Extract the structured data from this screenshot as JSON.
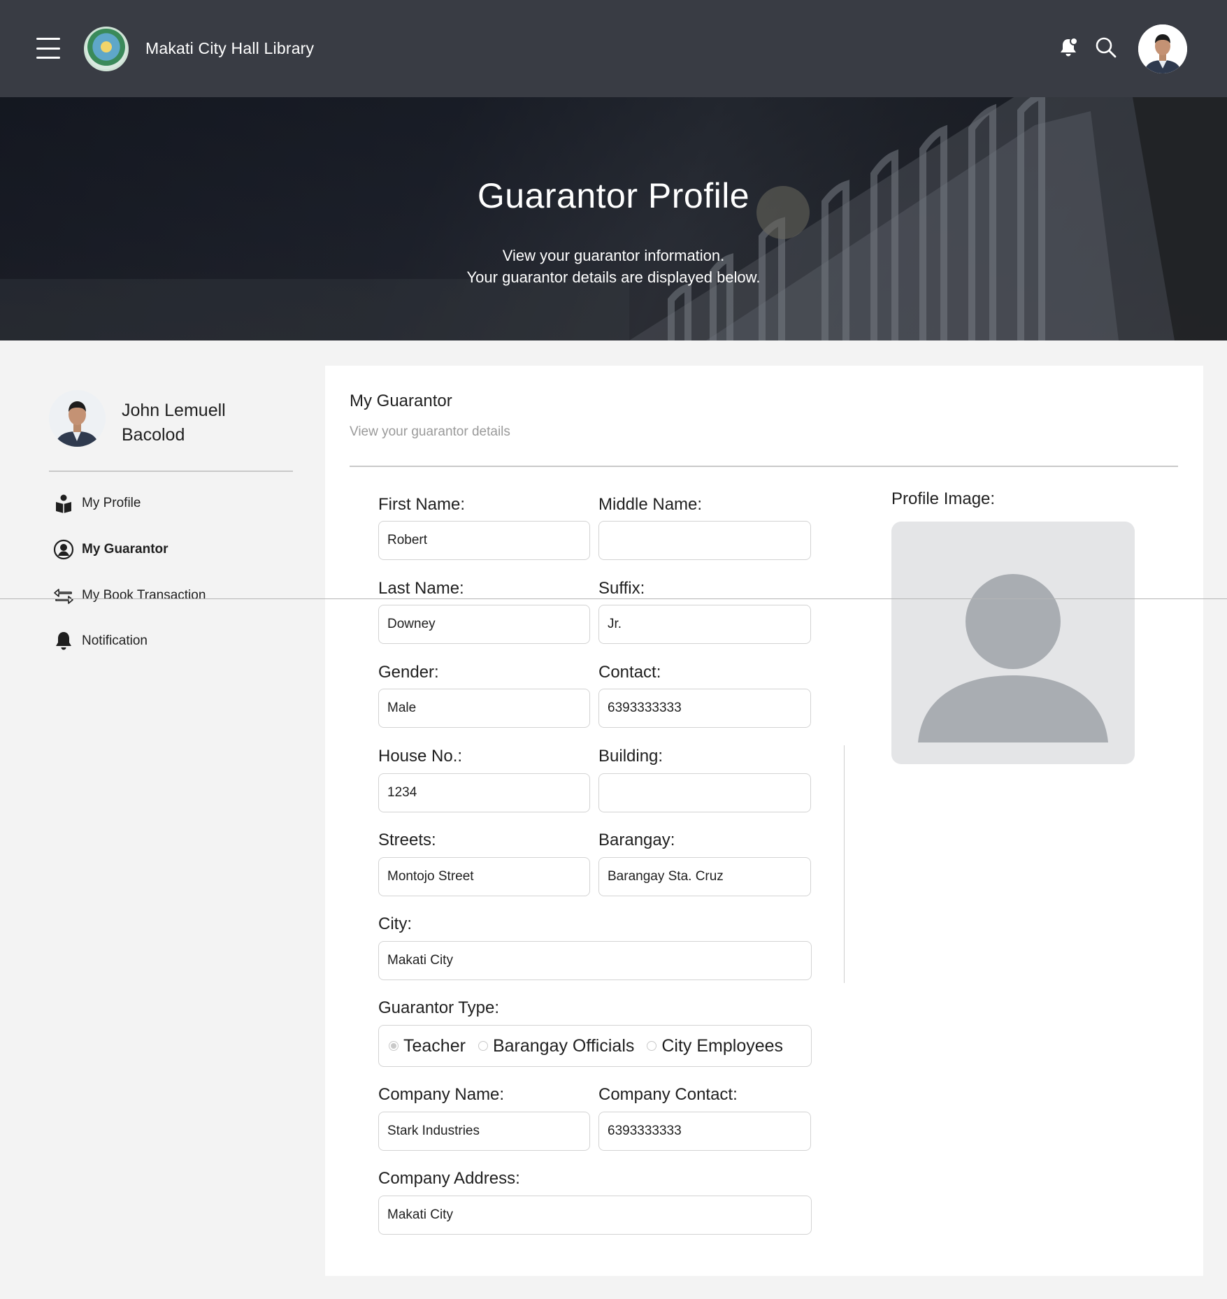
{
  "header": {
    "brand": "Makati City Hall Library"
  },
  "hero": {
    "title": "Guarantor Profile",
    "subtitle_line1": "View your guarantor information.",
    "subtitle_line2": "Your guarantor details are displayed below."
  },
  "sidebar": {
    "user_name": "John Lemuell Bacolod",
    "items": [
      {
        "label": "My Profile",
        "icon": "user-book-icon",
        "active": false
      },
      {
        "label": "My Guarantor",
        "icon": "user-circle-icon",
        "active": true
      },
      {
        "label": "My Book Transaction",
        "icon": "swap-arrows-icon",
        "active": false
      },
      {
        "label": "Notification",
        "icon": "bell-icon",
        "active": false
      }
    ]
  },
  "main": {
    "title": "My Guarantor",
    "subtitle": "View your guarantor details",
    "fields": {
      "first_name": {
        "label": "First Name:",
        "value": "Robert"
      },
      "middle_name": {
        "label": "Middle Name:",
        "value": ""
      },
      "last_name": {
        "label": "Last Name:",
        "value": "Downey"
      },
      "suffix": {
        "label": "Suffix:",
        "value": "Jr."
      },
      "gender": {
        "label": "Gender:",
        "value": "Male"
      },
      "contact": {
        "label": "Contact:",
        "value": "6393333333"
      },
      "house_no": {
        "label": "House No.:",
        "value": "1234"
      },
      "building": {
        "label": "Building:",
        "value": ""
      },
      "streets": {
        "label": "Streets:",
        "value": "Montojo Street"
      },
      "barangay": {
        "label": "Barangay:",
        "value": "Barangay Sta. Cruz"
      },
      "city": {
        "label": "City:",
        "value": "Makati City"
      },
      "company_name": {
        "label": "Company Name:",
        "value": "Stark Industries"
      },
      "company_contact": {
        "label": "Company Contact:",
        "value": "6393333333"
      },
      "company_address": {
        "label": "Company Address:",
        "value": "Makati City"
      }
    },
    "guarantor_type": {
      "label": "Guarantor Type:",
      "options": [
        "Teacher",
        "Barangay Officials",
        "City Employees"
      ],
      "selected": "Teacher"
    },
    "profile_image_label": "Profile Image:"
  },
  "colors": {
    "topbar": "#393c44",
    "page_bg": "#f3f3f3",
    "card_bg": "#ffffff",
    "placeholder_bg": "#e4e5e7",
    "placeholder_fg": "#a9adb2"
  }
}
